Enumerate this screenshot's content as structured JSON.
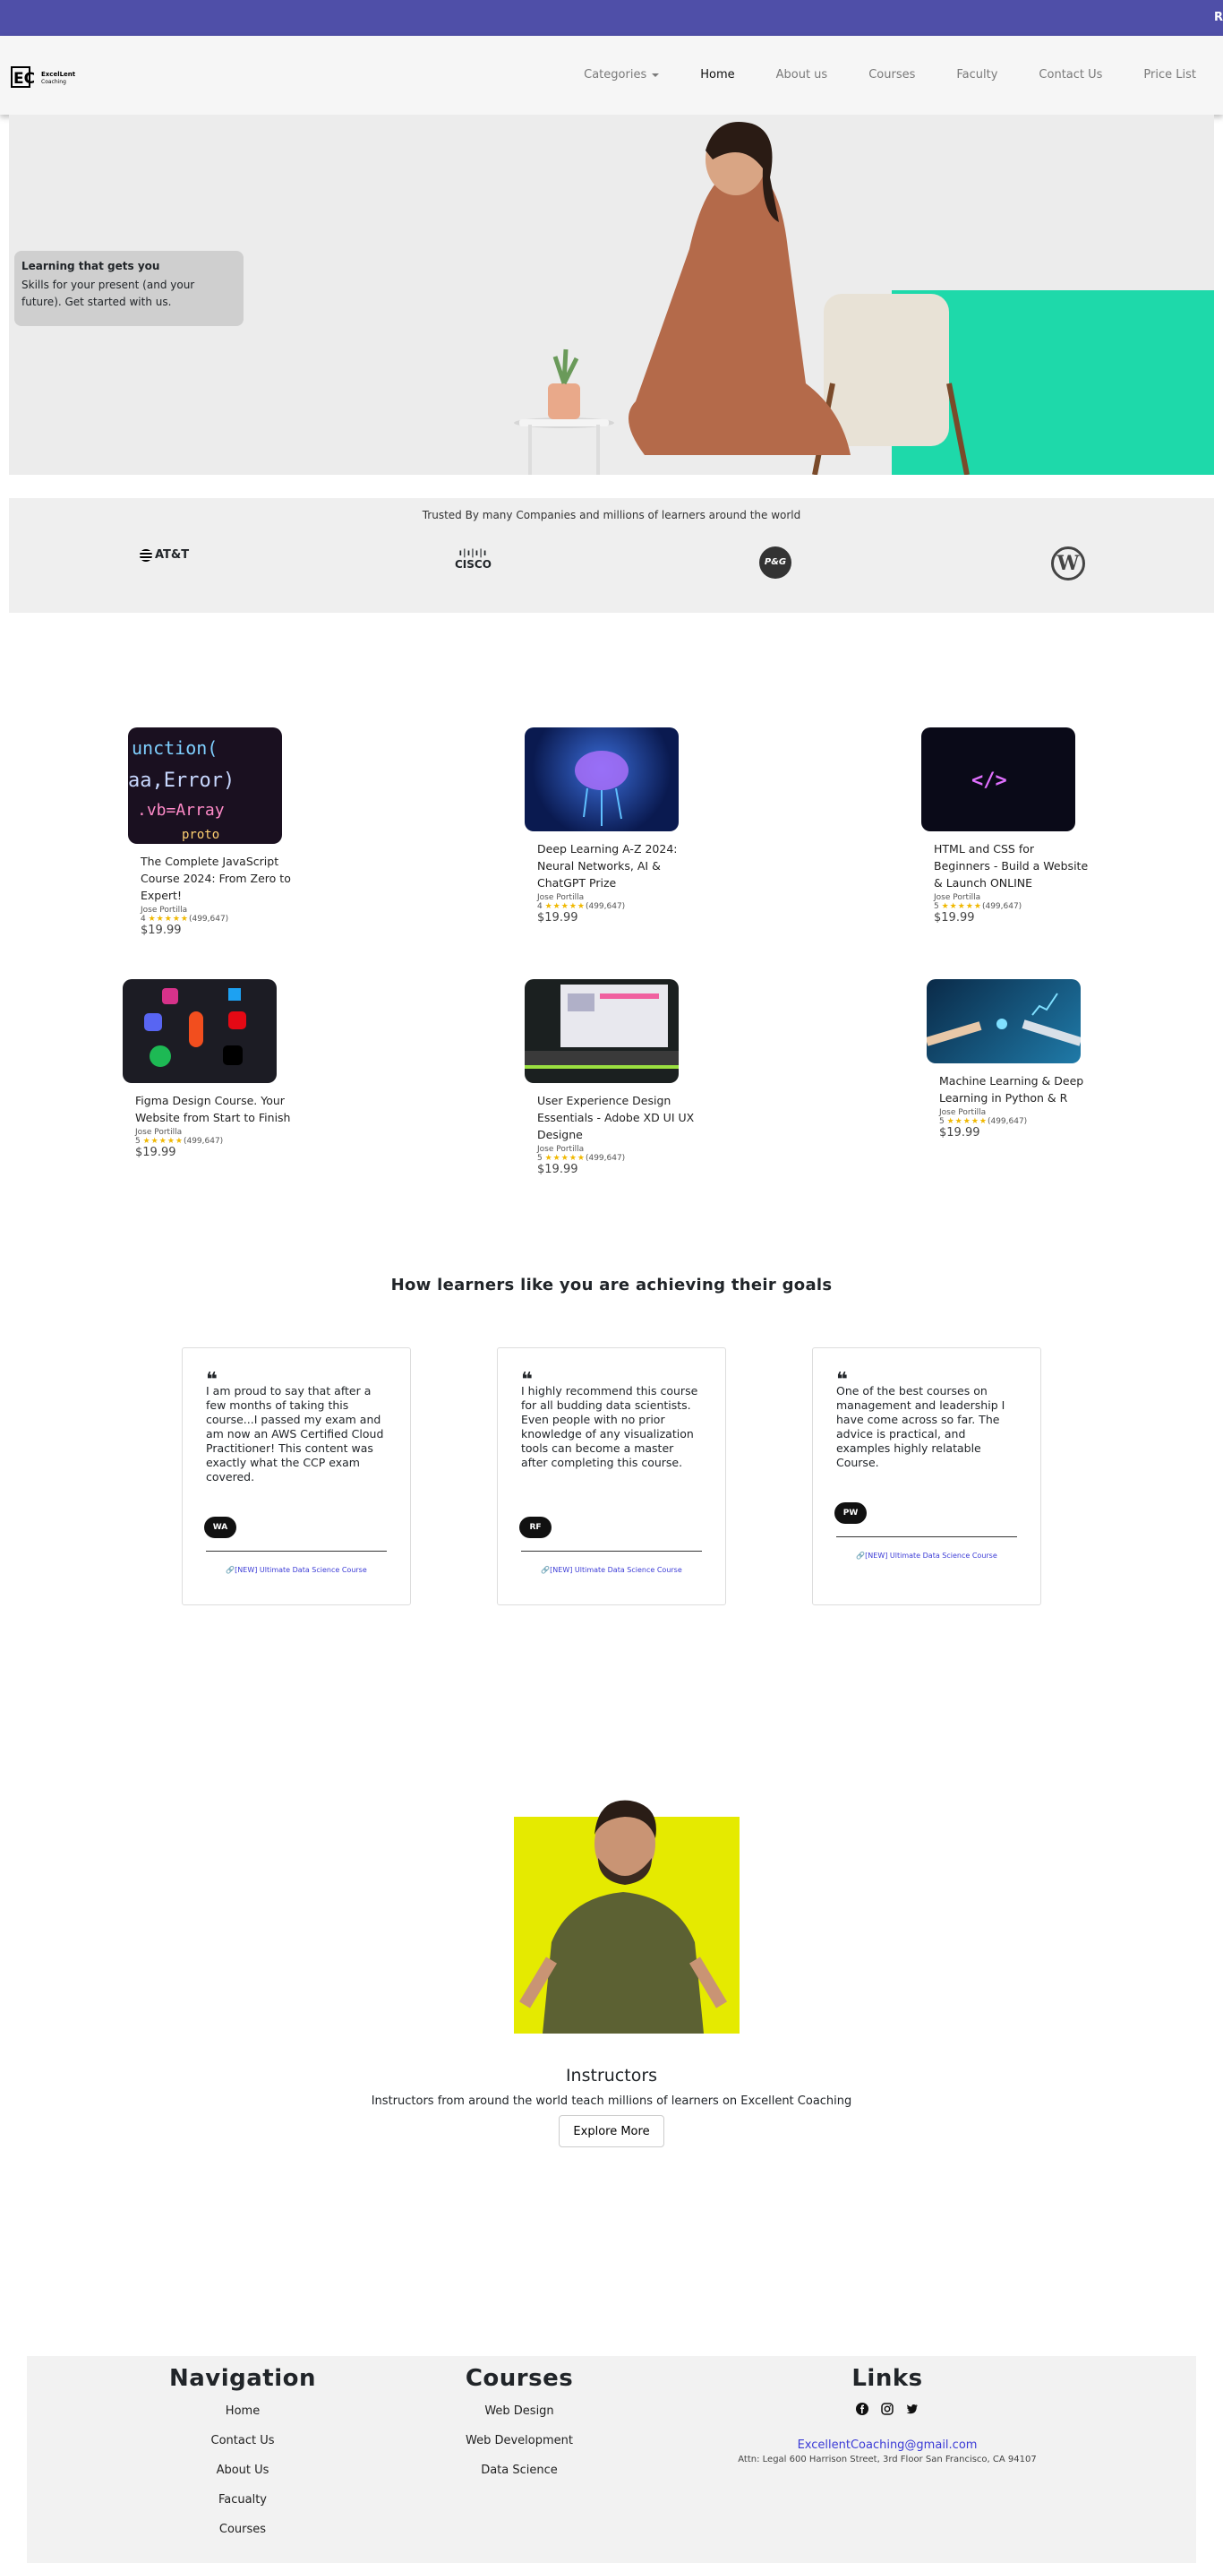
{
  "topbar": {
    "text": "R"
  },
  "nav": {
    "logo_text": "ExcelLent Coaching",
    "links": [
      "Categories",
      "Home",
      "About us",
      "Courses",
      "Faculty",
      "Contact Us",
      "Price List"
    ]
  },
  "hero": {
    "heading": "Learning that gets you",
    "text": "Skills for your present (and your future). Get started with us."
  },
  "trusted": {
    "caption": "Trusted By many Companies and millions of learners around the world",
    "brands": [
      "AT&T",
      "CISCO",
      "P&G",
      "W"
    ]
  },
  "courses": [
    {
      "title": "The Complete JavaScript Course 2024: From Zero to Expert!",
      "instructor": "Jose Portilla",
      "rating": "4",
      "stars": "★★★★★",
      "reviews": "(499,647)",
      "price": "$19.99"
    },
    {
      "title": "Deep Learning A-Z 2024: Neural Networks, AI & ChatGPT Prize",
      "instructor": "Jose Portilla",
      "rating": "4",
      "stars": "★★★★★",
      "reviews": "(499,647)",
      "price": "$19.99"
    },
    {
      "title": "HTML and CSS for Beginners - Build a Website & Launch ONLINE",
      "instructor": "Jose Portilla",
      "rating": "5",
      "stars": "★★★★★",
      "reviews": "(499,647)",
      "price": "$19.99"
    },
    {
      "title": "Figma Design Course. Your Website from Start to Finish",
      "instructor": "Jose Portilla",
      "rating": "5",
      "stars": "★★★★★",
      "reviews": "(499,647)",
      "price": "$19.99"
    },
    {
      "title": "User Experience Design Essentials - Adobe XD UI UX Designe",
      "instructor": "Jose Portilla",
      "rating": "5",
      "stars": "★★★★★",
      "reviews": "(499,647)",
      "price": "$19.99"
    },
    {
      "title": "Machine Learning & Deep Learning in Python & R",
      "instructor": "Jose Portilla",
      "rating": "5",
      "stars": "★★★★★",
      "reviews": "(499,647)",
      "price": "$19.99"
    }
  ],
  "testimonials": {
    "heading": "How learners like you are achieving their goals",
    "items": [
      {
        "quote_mark": "❝",
        "text": "I am proud to say that after a few months of taking this course...I passed my exam and am now an AWS Certified Cloud Practitioner! This content was exactly what the CCP exam covered.",
        "initials": "WA",
        "course": "[NEW] Ultimate Data Science Course"
      },
      {
        "quote_mark": "❝",
        "text": "I highly recommend this course for all budding data scientists. Even people with no prior knowledge of any visualization tools can become a master after completing this course.",
        "initials": "RF",
        "course": "[NEW] Ultimate Data Science Course"
      },
      {
        "quote_mark": "❝",
        "text": "One of the best courses on management and leadership I have come across so far. The advice is practical, and examples highly relatable Course.",
        "initials": "PW",
        "course": "[NEW] Ultimate Data Science Course"
      }
    ]
  },
  "instructors": {
    "title": "Instructors",
    "subtitle": "Instructors from around the world teach millions of learners on Excellent Coaching",
    "button": "Explore More"
  },
  "footer": {
    "nav_title": "Navigation",
    "nav_links": [
      "Home",
      "Contact Us",
      "About Us",
      "Facualty",
      "Courses"
    ],
    "courses_title": "Courses",
    "course_links": [
      "Web Design",
      "Web Development",
      "Data Science"
    ],
    "links_title": "Links",
    "email": "ExcellentCoaching@gmail.com",
    "address": "Attn: Legal 600 Harrison Street, 3rd Floor San Francisco, CA 94107"
  },
  "colors": {
    "topbar": "#4f4fa8",
    "teal": "#1ed9aa",
    "instructor_bg": "#e5ea00",
    "star": "#f0b800",
    "link": "#3b3bd6"
  }
}
